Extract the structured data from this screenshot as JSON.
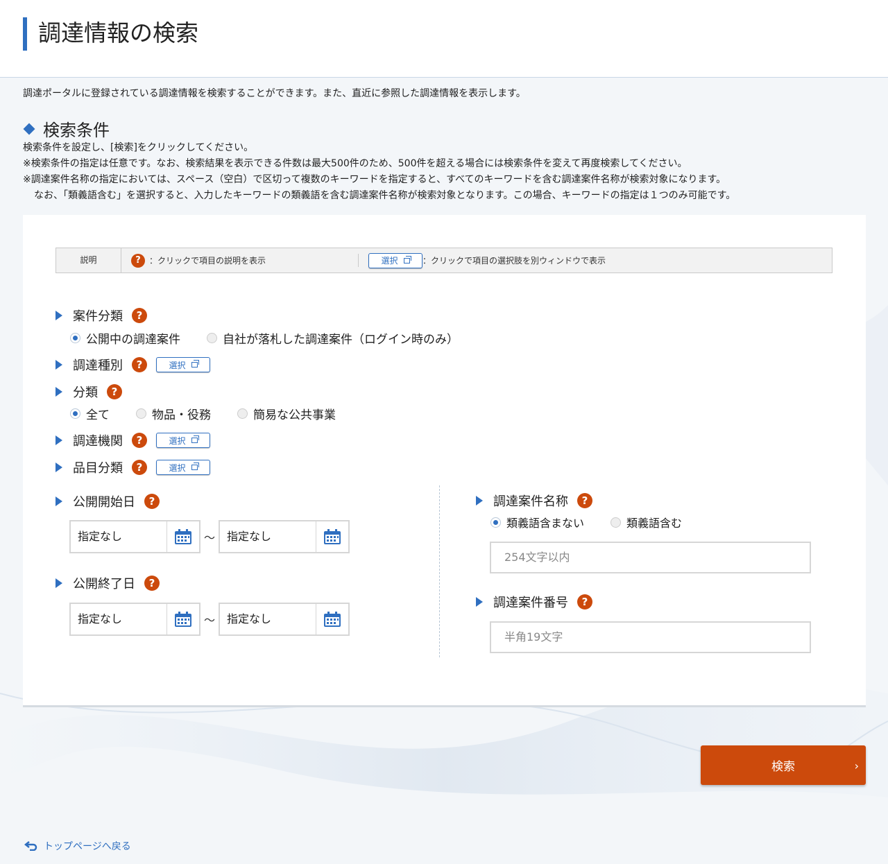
{
  "page": {
    "title": "調達情報の検索",
    "intro": "調達ポータルに登録されている調達情報を検索することができます。また、直近に参照した調達情報を表示します。"
  },
  "conditions": {
    "heading": "検索条件",
    "notes": [
      "検索条件を設定し、[検索]をクリックしてください。",
      "※検索条件の指定は任意です。なお、検索結果を表示できる件数は最大500件のため、500件を超える場合には検索条件を変えて再度検索してください。",
      "※調達案件名称の指定においては、スペース（空白）で区切って複数のキーワードを指定すると、すべてのキーワードを含む調達案件名称が検索対象になります。",
      "なお、「類義語含む」を選択すると、入力したキーワードの類義語を含む調達案件名称が検索対象となります。この場合、キーワードの指定は１つのみ可能です。"
    ]
  },
  "legend": {
    "label": "説明",
    "help_text": "：クリックで項目の説明を表示",
    "select_text": "：クリックで項目の選択肢を別ウィンドウで表示"
  },
  "common": {
    "help_icon": "?",
    "select_label": "選択",
    "tilde": "～"
  },
  "fields": {
    "case_type": {
      "label": "案件分類",
      "options": [
        "公開中の調達案件",
        "自社が落札した調達案件（ログイン時のみ）"
      ]
    },
    "procurement_type": {
      "label": "調達種別"
    },
    "category": {
      "label": "分類",
      "options": [
        "全て",
        "物品・役務",
        "簡易な公共事業"
      ]
    },
    "agency": {
      "label": "調達機関"
    },
    "item_category": {
      "label": "品目分類"
    },
    "publish_start": {
      "label": "公開開始日",
      "from": "指定なし",
      "to": "指定なし"
    },
    "publish_end": {
      "label": "公開終了日",
      "from": "指定なし",
      "to": "指定なし"
    },
    "case_name": {
      "label": "調達案件名称",
      "options": [
        "類義語含まない",
        "類義語含む"
      ],
      "placeholder": "254文字以内"
    },
    "case_number": {
      "label": "調達案件番号",
      "placeholder": "半角19文字"
    }
  },
  "actions": {
    "search_label": "検索",
    "back_label": "トップページへ戻る"
  },
  "colors": {
    "accent": "#2f6fc0",
    "help": "#cc4a0c",
    "search_button": "#cc4a0c"
  }
}
